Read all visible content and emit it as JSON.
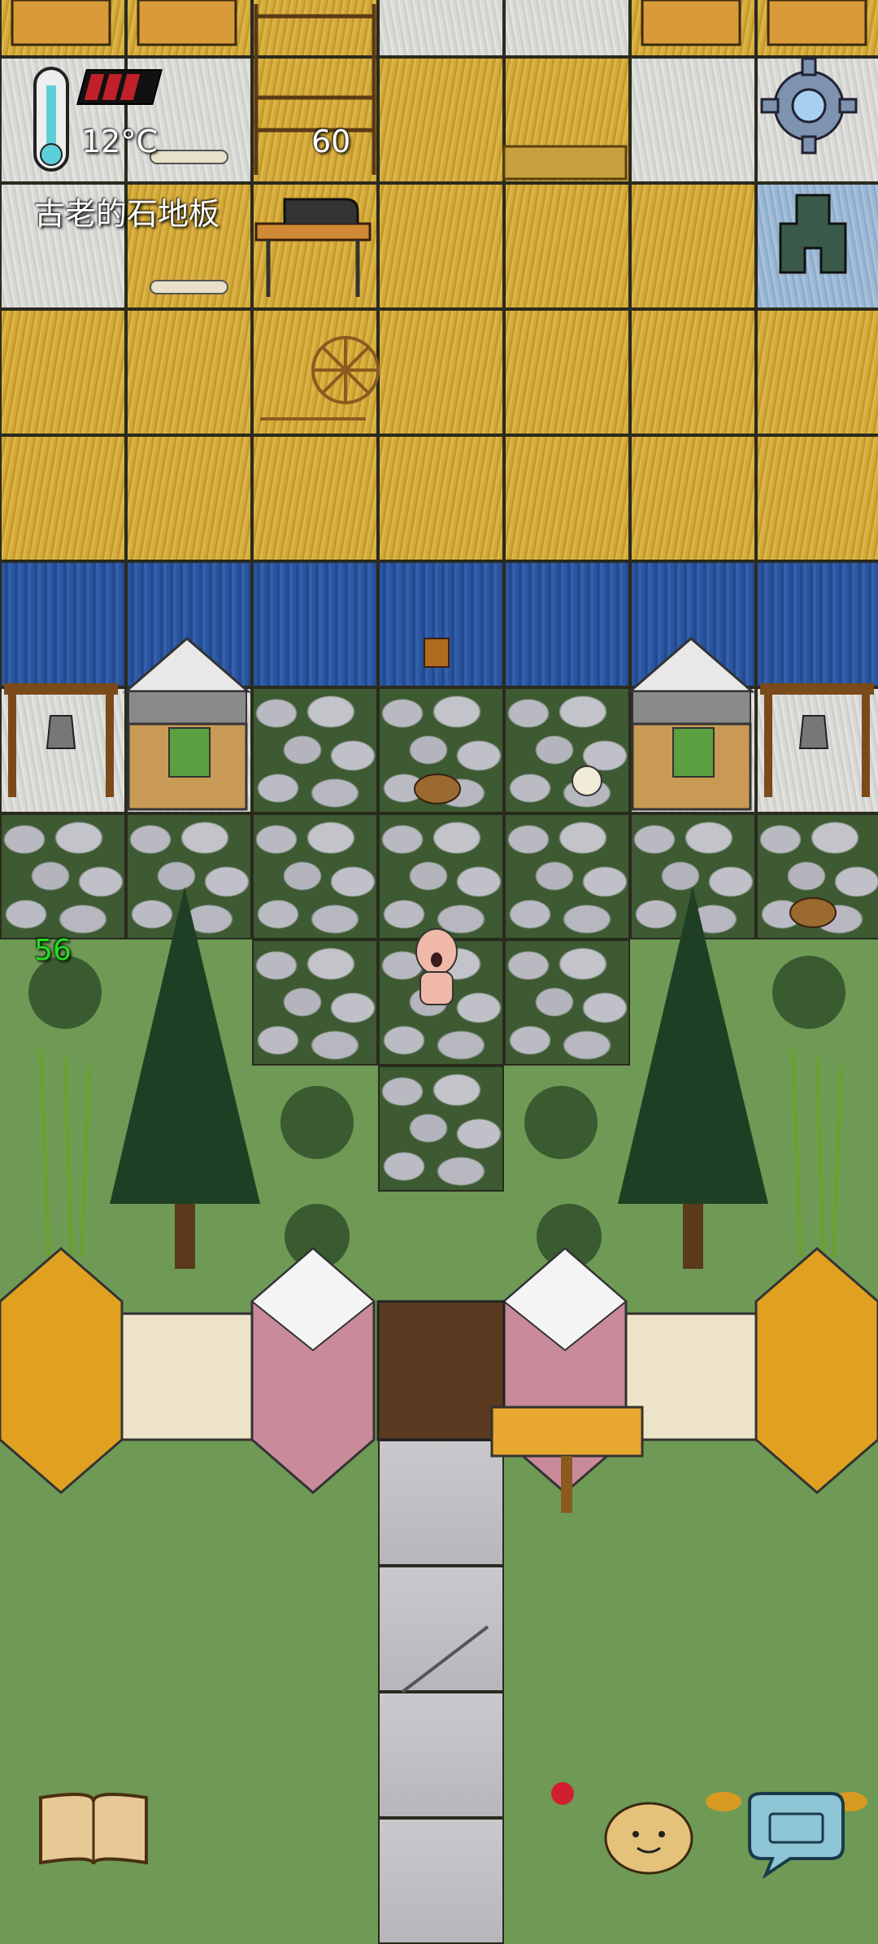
{
  "hud": {
    "temperature": "12°C",
    "counter": "60",
    "tile_name": "古老的石地板",
    "age_indicator": "56",
    "food_bars": 3
  },
  "icons": {
    "thermometer": "thermometer-icon",
    "food": "food-meter-icon",
    "settings": "gear-icon",
    "home_marker": "home-marker-icon",
    "recipe_book": "book-icon",
    "emote": "emote-face-icon",
    "chat": "keyboard-chat-icon"
  },
  "colors": {
    "grass": "#6f9a55",
    "straw": "#d4aa39",
    "water": "#2b55a0",
    "food_bar": "#c0202a",
    "age_text": "#22dd22"
  }
}
